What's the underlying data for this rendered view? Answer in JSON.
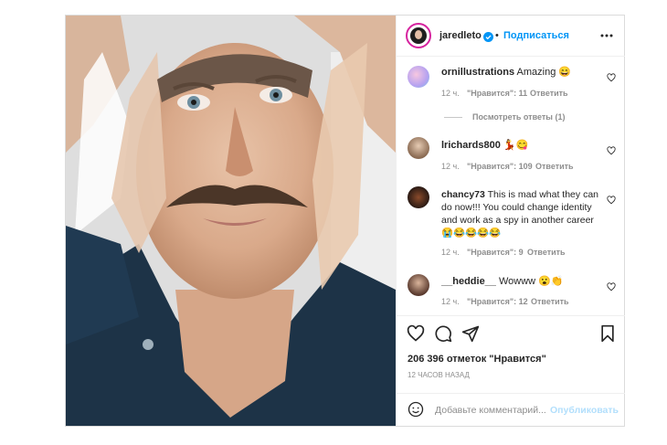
{
  "header": {
    "username": "jaredleto",
    "verified_icon": "verified-badge-icon",
    "dot": "•",
    "follow_label": "Подписаться",
    "more_icon": "more-options-icon"
  },
  "comments": [
    {
      "user": "ornillustrations",
      "text": "Amazing 😄",
      "time": "12 ч.",
      "likes": "\"Нравится\": 11",
      "reply": "Ответить"
    },
    {
      "user": "lrichards800",
      "text": "💃😋",
      "time": "12 ч.",
      "likes": "\"Нравится\": 109",
      "reply": "Ответить"
    },
    {
      "user": "chancy73",
      "text": "This is mad what they can do now!!! You could change identity and work as a spy in another career 😭😂😂😂😂",
      "time": "12 ч.",
      "likes": "\"Нравится\": 9",
      "reply": "Ответить"
    },
    {
      "user": "__heddie__",
      "text": "Wowww 😮👏",
      "time": "12 ч.",
      "likes": "\"Нравится\": 12",
      "reply": "Ответить"
    }
  ],
  "view_replies": "Посмотреть ответы (1)",
  "actions": {
    "like_icon": "heart-icon",
    "comment_icon": "comment-icon",
    "share_icon": "share-icon",
    "save_icon": "bookmark-icon"
  },
  "likes_total": "206 396 отметок \"Нравится\"",
  "posted_time": "12 ЧАСОВ НАЗАД",
  "add_comment": {
    "placeholder": "Добавьте комментарий...",
    "post_label": "Опубликовать",
    "emoji_icon": "emoji-icon"
  },
  "colors": {
    "accent": "#0095f6",
    "border": "#dbdbdb",
    "meta": "#8e8e8e"
  }
}
